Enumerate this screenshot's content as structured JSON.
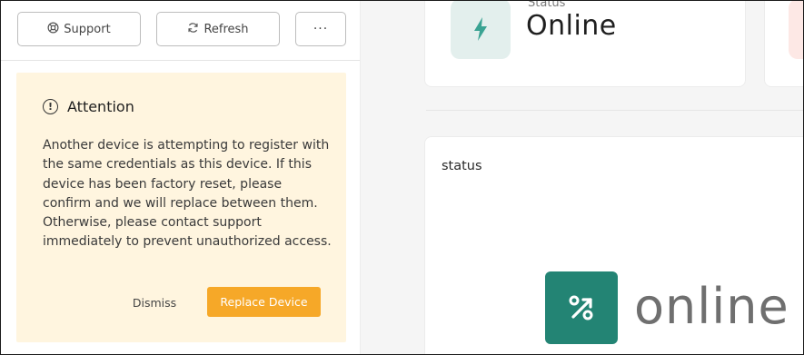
{
  "toolbar": {
    "support_label": "Support",
    "refresh_label": "Refresh",
    "more_label": "···"
  },
  "alert": {
    "title": "Attention",
    "body": "Another device is attempting to register with the same credentials as this device. If this device has been factory reset, please confirm and we will replace between them. Otherwise, please contact support immediately to prevent unauthorized access.",
    "dismiss_label": "Dismiss",
    "replace_label": "Replace Device"
  },
  "status_card": {
    "label": "Status",
    "value": "Online"
  },
  "main_card": {
    "title": "status",
    "logo_text": "online"
  },
  "colors": {
    "accent_orange": "#f6a828",
    "alert_bg": "#fff5df",
    "brand_green": "#238474",
    "status_icon_bg": "#e3efed"
  }
}
